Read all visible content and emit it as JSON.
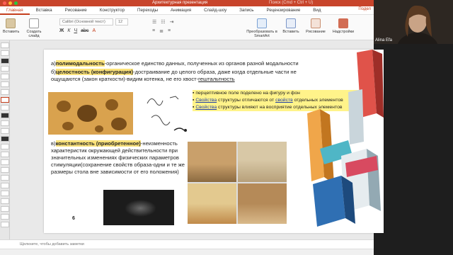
{
  "window": {
    "title": "Архитектурная презентация",
    "search_hint": "Поиск (Cmd + Ctrl + U)"
  },
  "tabs": [
    "Главная",
    "Вставка",
    "Рисование",
    "Конструктор",
    "Переходы",
    "Анимация",
    "Слайд-шоу",
    "Запись",
    "Рецензирование",
    "Вид"
  ],
  "share_label": "Подел",
  "ribbon": {
    "paste_label": "Вставить",
    "new_slide_label": "Создать слайд",
    "font": "Calibri (Основной текст)",
    "size": "12",
    "smartart_label": "Преобразовать в SmartArt",
    "insert_label": "Вставить",
    "drawing_label": "Рисование",
    "addins_label": "Надстройки"
  },
  "slide": {
    "line_a": {
      "prefix": "а)",
      "term": "полимодальность",
      "rest": "-органическое единство данных, полученных из органов разной модальности"
    },
    "line_b": {
      "prefix": "б)",
      "term": "целостность (конфигурация)",
      "rest": "-достраивание до целого образа, даже когда отдельные части не",
      "cont": "ощущаются (закон краткости)-видим котенка, не его хвост-",
      "link": "гештальтность"
    },
    "bullets": [
      {
        "pre": "",
        "link": "",
        "post": "перцептивное поле поделено на фигуру и фон"
      },
      {
        "pre": "",
        "link": "Свойства",
        "post": " структуры отличаются от ",
        "link2": "свойств",
        "post2": " отдельных элементов"
      },
      {
        "pre": "",
        "link": "Свойства",
        "post": " структуры влияют на восприятие отдельных элементов"
      }
    ],
    "line_c": {
      "prefix": "в)",
      "term": "константность (приобретенное)",
      "rest": "-неизменность",
      "body": "характеристик окружающей действительности при значительных изменениях физических параметров стимуляции(сохранение свойств образа-одни и те же размеры стола вне зависимости от его положения)"
    },
    "page_num": "6"
  },
  "notes_placeholder": "Щелкните, чтобы добавить заметки",
  "webcam": {
    "name": "Alina Efa"
  },
  "colors": {
    "accent": "#c43e1c",
    "highlight": "#fbe27a",
    "link": "#1f3fa6"
  }
}
